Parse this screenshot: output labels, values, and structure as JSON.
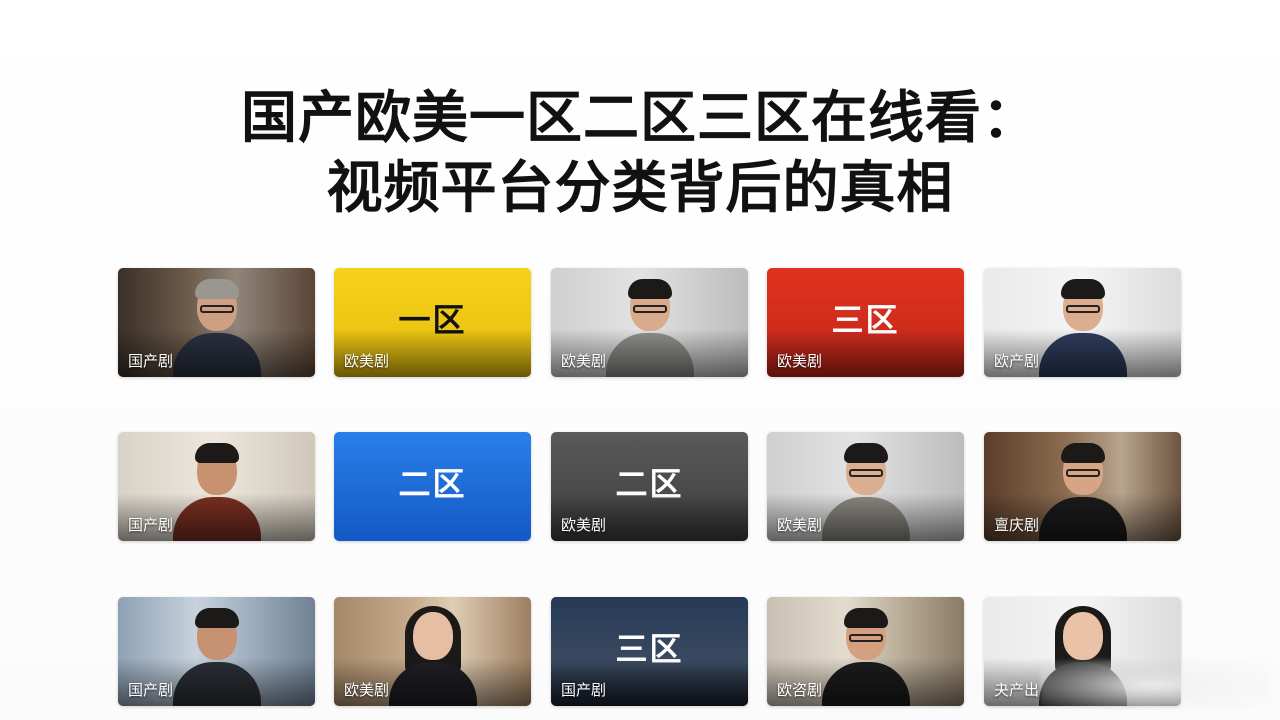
{
  "title_line1": "国产欧美一区二区三区在线看：",
  "title_line2": "视频平台分类背后的真相",
  "cards": [
    {
      "label": "国产剧",
      "zone": ""
    },
    {
      "label": "欧美剧",
      "zone": "一区"
    },
    {
      "label": "欧美剧",
      "zone": ""
    },
    {
      "label": "欧美剧",
      "zone": "三区"
    },
    {
      "label": "欧产剧",
      "zone": ""
    },
    {
      "label": "国产剧",
      "zone": ""
    },
    {
      "label": "",
      "zone": "二区"
    },
    {
      "label": "欧美剧",
      "zone": "二区"
    },
    {
      "label": "欧美剧",
      "zone": ""
    },
    {
      "label": "亶庆剧",
      "zone": ""
    },
    {
      "label": "国产剧",
      "zone": ""
    },
    {
      "label": "欧美剧",
      "zone": ""
    },
    {
      "label": "国产剧",
      "zone": "三区"
    },
    {
      "label": "欧咨剧",
      "zone": ""
    },
    {
      "label": "夬产出",
      "zone": ""
    }
  ],
  "colors": {
    "yellow": "#f7d21a",
    "red": "#e0321f",
    "blue": "#2a7fe8",
    "gray": "#4a4a4a",
    "night": "#263a57"
  }
}
